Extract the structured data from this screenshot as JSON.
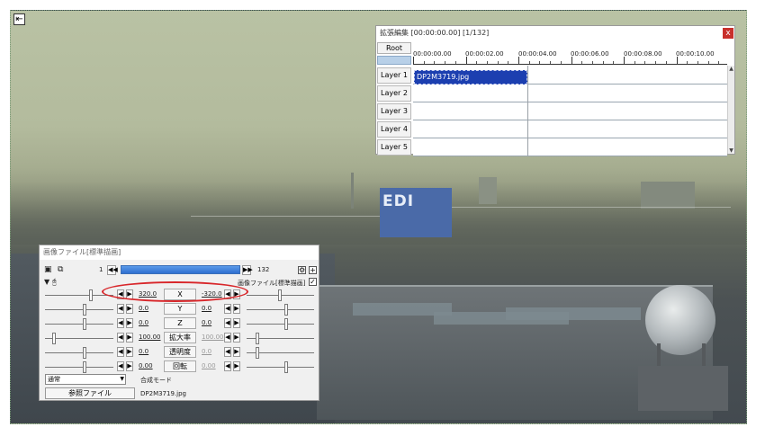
{
  "colors": {
    "accent_red": "#d8262a",
    "clip_blue": "#1c3fb0",
    "frame_bar_blue": "#2f6fd0"
  },
  "photo": {
    "billboard_text": "EDI",
    "billboard_right": "EDI"
  },
  "back_button": {
    "icon": "back-to-start-icon",
    "glyph": "⇤"
  },
  "ext_editor": {
    "title": "拡張編集 [00:00:00.00] [1/132]",
    "close_label": "x",
    "root_label": "Root",
    "ticks": [
      "00:00:00.00",
      "00:00:02.00",
      "00:00:04.00",
      "00:00:06.00",
      "00:00:08.00",
      "00:00:10.00"
    ],
    "layers": [
      "Layer 1",
      "Layer 2",
      "Layer 3",
      "Layer 4",
      "Layer 5"
    ],
    "clip_name": "DP2M3719.jpg"
  },
  "image_window": {
    "title": "画像ファイル[標準描画]",
    "frame_start": "1",
    "frame_end": "132",
    "filter_label": "画像ファイル[標準描画]",
    "params": [
      {
        "left": "320.0",
        "label": "X",
        "right": "-320.0",
        "right_dim": false
      },
      {
        "left": "0.0",
        "label": "Y",
        "right": "0.0",
        "right_dim": false
      },
      {
        "left": "0.0",
        "label": "Z",
        "right": "0.0",
        "right_dim": false
      },
      {
        "left": "100.00",
        "label": "拡大率",
        "right": "100.00",
        "right_dim": true
      },
      {
        "left": "0.0",
        "label": "透明度",
        "right": "0.0",
        "right_dim": true
      },
      {
        "left": "0.00",
        "label": "回転",
        "right": "0.00",
        "right_dim": true
      }
    ],
    "blend_select": "通常",
    "blend_label": "合成モード",
    "ref_button": "参照ファイル",
    "file_name": "DP2M3719.jpg"
  }
}
